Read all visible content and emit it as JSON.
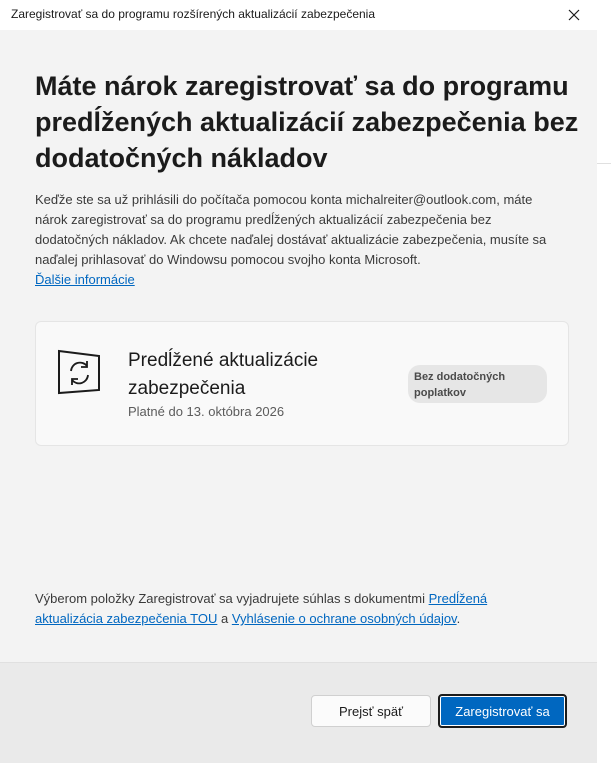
{
  "window": {
    "title": "Zaregistrovať sa do programu rozšírených aktualizácií zabezpečenia",
    "close_icon": "close-icon"
  },
  "main": {
    "headline": "Máte nárok zaregistrovať sa do programu predĺžených aktualizácií zabezpečenia bez dodatočných nákladov",
    "body": "Keďže ste sa už prihlásili do počítača pomocou konta michalreiter@outlook.com, máte nárok zaregistrovať sa do programu predĺžených aktualizácií zabezpečenia bez dodatočných nákladov. Ak chcete naďalej dostávať aktualizácie zabezpečenia, musíte sa naďalej prihlasovať do Windowsu pomocou svojho konta Microsoft.",
    "learn_more": "Ďalšie informácie"
  },
  "card": {
    "icon": "update-sync-icon",
    "title": "Predĺžené aktualizácie zabezpečenia",
    "subtitle": "Platné do 13. októbra 2026",
    "badge": "Bez dodatočných poplatkov"
  },
  "consent": {
    "prefix": "Výberom položky Zaregistrovať sa vyjadrujete súhlas s dokumentmi ",
    "link1": "Predĺžená aktualizácia zabezpečenia TOU",
    "middle": " a ",
    "link2": "Vyhlásenie o ochrane osobných údajov",
    "suffix": "."
  },
  "footer": {
    "back_label": "Prejsť späť",
    "enroll_label": "Zaregistrovať sa"
  },
  "colors": {
    "accent": "#0067c0",
    "background": "#f3f3f3"
  }
}
